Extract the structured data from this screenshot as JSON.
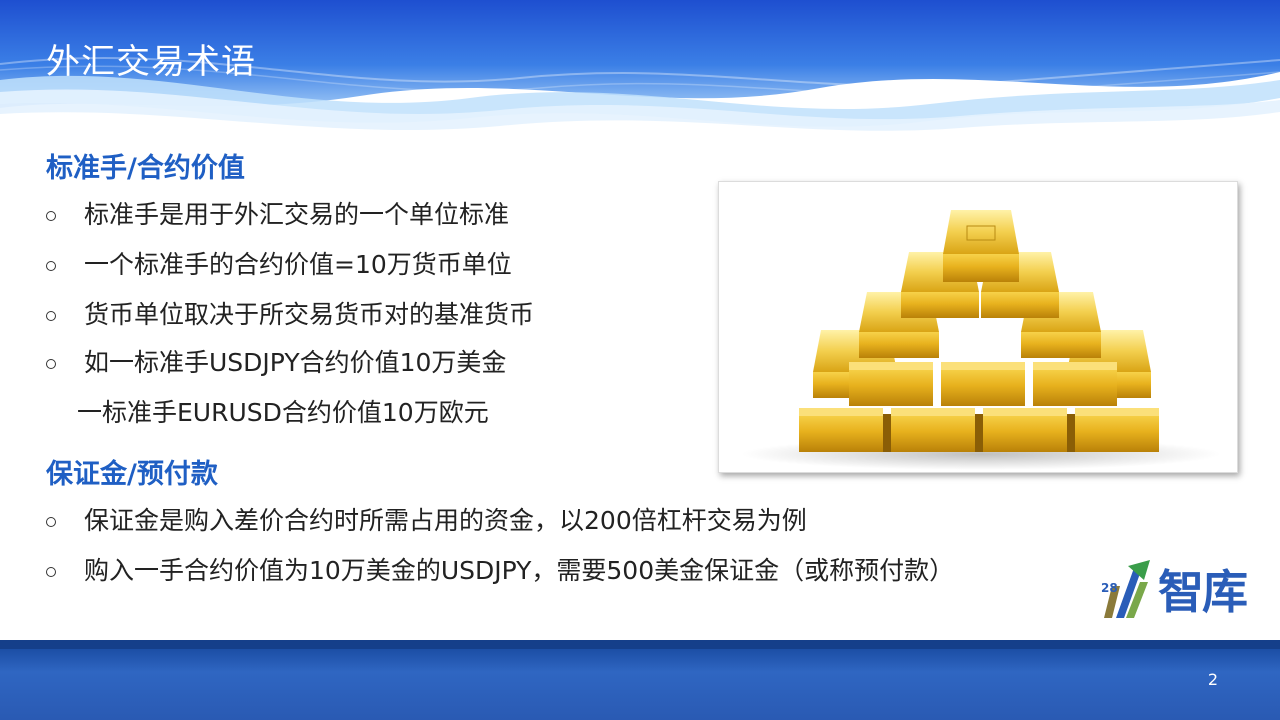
{
  "slide": {
    "title": "外汇交易术语",
    "page_number": "2"
  },
  "section1": {
    "heading": "标准手/合约价值",
    "bullets": [
      "标准手是用于外汇交易的一个单位标准",
      "一个标准手的合约价值=10万货币单位",
      "货币单位取决于所交易货币对的基准货币",
      "如一标准手USDJPY合约价值10万美金"
    ],
    "continuation": "一标准手EURUSD合约价值10万欧元"
  },
  "section2": {
    "heading": "保证金/预付款",
    "bullets": [
      "保证金是购入差价合约时所需占用的资金，以200倍杠杆交易为例",
      "购入一手合约价值为10万美金的USDJPY，需要500美金保证金（或称预付款）"
    ]
  },
  "logo": {
    "number": "28",
    "text": "智库"
  },
  "colors": {
    "header_blue": "#2a63d6",
    "heading_blue": "#1f5fc4",
    "gold": "#e3b21f",
    "footer_blue": "#2a5ab3"
  }
}
